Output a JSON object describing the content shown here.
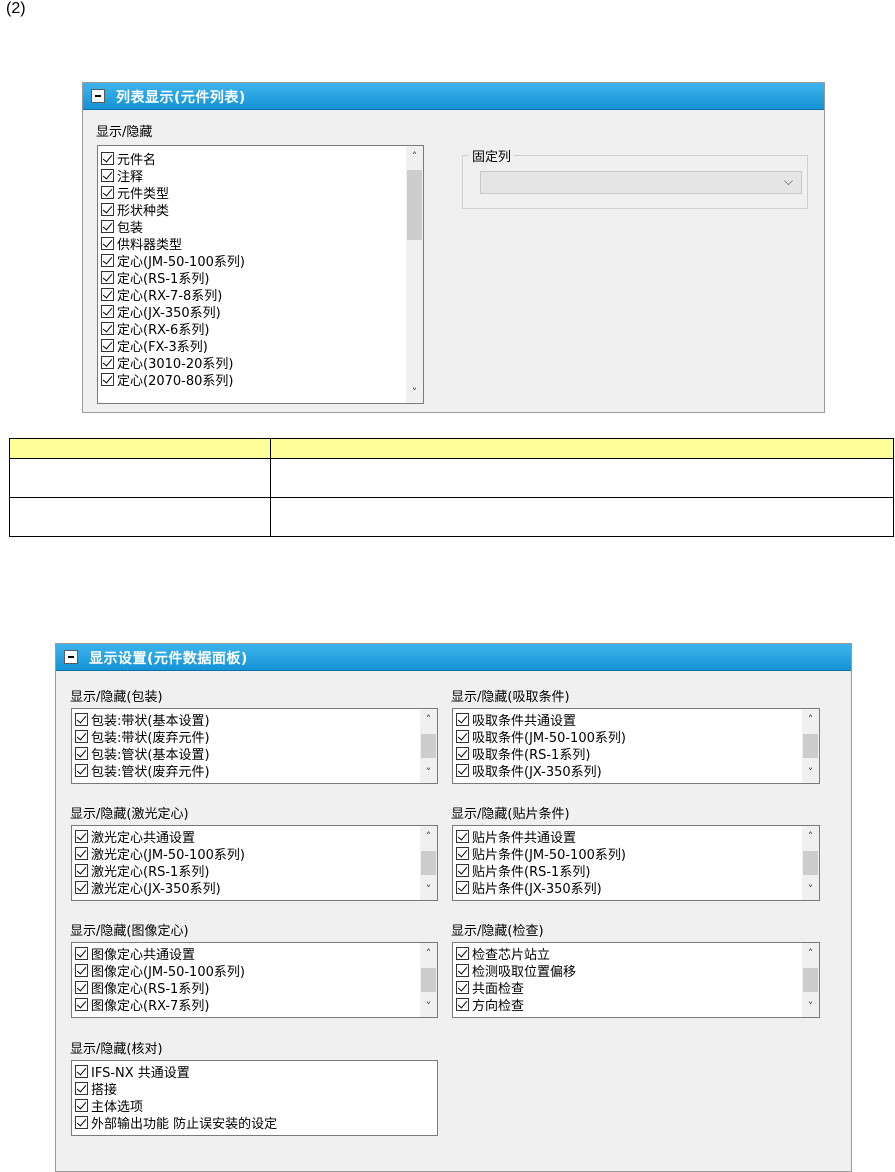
{
  "section_label": "(2)",
  "panel1": {
    "title": "列表显示(元件列表)",
    "show_hide_label": "显示/隐藏",
    "items": [
      "元件名",
      "注释",
      "元件类型",
      "形状种类",
      "包装",
      "供料器类型",
      "定心(JM-50-100系列)",
      "定心(RS-1系列)",
      "定心(RX-7-8系列)",
      "定心(JX-350系列)",
      "定心(RX-6系列)",
      "定心(FX-3系列)",
      "定心(3010-20系列)",
      "定心(2070-80系列)"
    ],
    "fixed_column_label": "固定列",
    "fixed_column_value": ""
  },
  "table": {
    "header": [
      "",
      ""
    ],
    "rows": [
      [
        "",
        ""
      ],
      [
        "",
        ""
      ]
    ]
  },
  "panel2": {
    "title": "显示设置(元件数据面板)",
    "groups": {
      "packaging": {
        "label": "显示/隐藏(包装)",
        "items": [
          "包装:带状(基本设置)",
          "包装:带状(废弃元件)",
          "包装:管状(基本设置)",
          "包装:管状(废弃元件)"
        ]
      },
      "pick": {
        "label": "显示/隐藏(吸取条件)",
        "items": [
          "吸取条件共通设置",
          "吸取条件(JM-50-100系列)",
          "吸取条件(RS-1系列)",
          "吸取条件(JX-350系列)"
        ]
      },
      "laser": {
        "label": "显示/隐藏(激光定心)",
        "items": [
          "激光定心共通设置",
          "激光定心(JM-50-100系列)",
          "激光定心(RS-1系列)",
          "激光定心(JX-350系列)"
        ]
      },
      "mount": {
        "label": "显示/隐藏(贴片条件)",
        "items": [
          "贴片条件共通设置",
          "贴片条件(JM-50-100系列)",
          "贴片条件(RS-1系列)",
          "贴片条件(JX-350系列)"
        ]
      },
      "vision": {
        "label": "显示/隐藏(图像定心)",
        "items": [
          "图像定心共通设置",
          "图像定心(JM-50-100系列)",
          "图像定心(RS-1系列)",
          "图像定心(RX-7系列)"
        ]
      },
      "inspection": {
        "label": "显示/隐藏(检查)",
        "items": [
          "检查芯片站立",
          "检测吸取位置偏移",
          "共面检查",
          "方向检查"
        ]
      },
      "verify": {
        "label": "显示/隐藏(核对)",
        "items": [
          "IFS-NX 共通设置",
          "搭接",
          "主体选项",
          "外部输出功能  防止误安装的设定"
        ]
      }
    }
  },
  "colors": {
    "header_blue": "#1593d6",
    "table_header_yellow": "#ffff99",
    "panel_bg": "#f0f0f0"
  }
}
